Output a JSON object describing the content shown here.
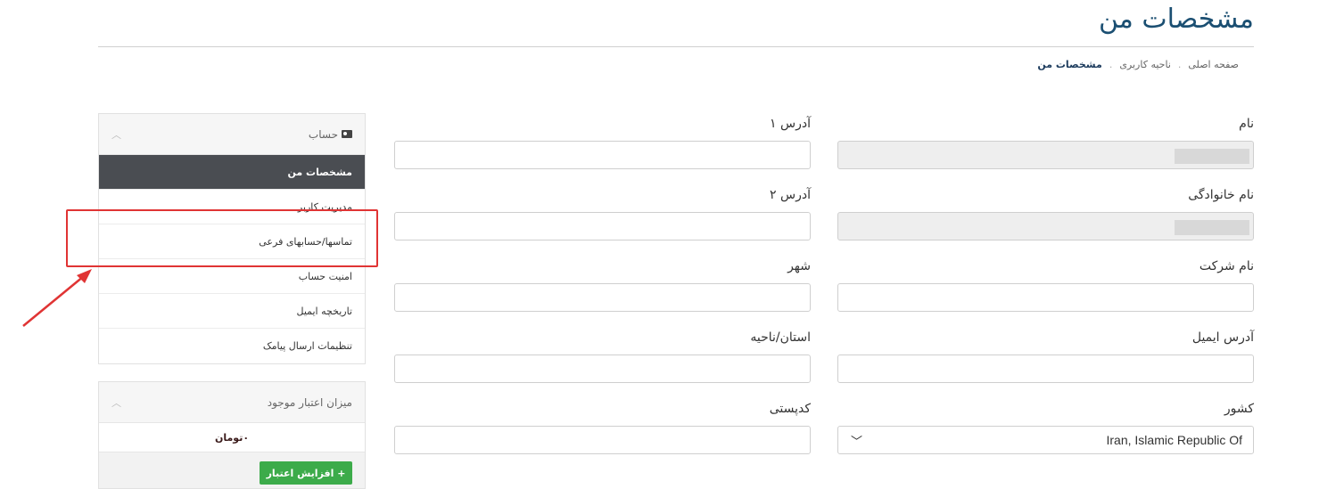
{
  "page": {
    "title": "مشخصات من"
  },
  "breadcrumb": [
    {
      "label": "صفحه اصلی"
    },
    {
      "label": "ناحیه کاربری"
    },
    {
      "label": "مشخصات من"
    }
  ],
  "sidebar": {
    "account_title": "حساب",
    "items": [
      {
        "label": "مشخصات من"
      },
      {
        "label": "مدیریت کاربر"
      },
      {
        "label": "تماسها/حسابهای فرعی"
      },
      {
        "label": "امنیت حساب"
      },
      {
        "label": "تاریخچه ایمیل"
      },
      {
        "label": "تنظیمات ارسال پیامک"
      }
    ],
    "credit_title": "میزان اعتبار موجود",
    "credit_amount": "۰تومان",
    "credit_button": "+ افزایش اعتبار"
  },
  "form": {
    "right": [
      {
        "label": "نام",
        "value": "",
        "disabled": true
      },
      {
        "label": "نام خانوادگی",
        "value": "",
        "disabled": true
      },
      {
        "label": "نام شرکت",
        "value": ""
      },
      {
        "label": "آدرس ایمیل",
        "value": ""
      },
      {
        "label": "کشور",
        "value": "Iran, Islamic Republic Of"
      }
    ],
    "left": [
      {
        "label": "آدرس ۱",
        "value": ""
      },
      {
        "label": "آدرس ۲",
        "value": ""
      },
      {
        "label": "شهر",
        "value": ""
      },
      {
        "label": "استان/ناحیه",
        "value": ""
      },
      {
        "label": "کدپستی",
        "value": ""
      }
    ]
  },
  "colors": {
    "annotation": "#e03434",
    "accent_title": "#1b4f72",
    "active_menu": "#4a4d52",
    "button_green": "#3cab4a"
  }
}
